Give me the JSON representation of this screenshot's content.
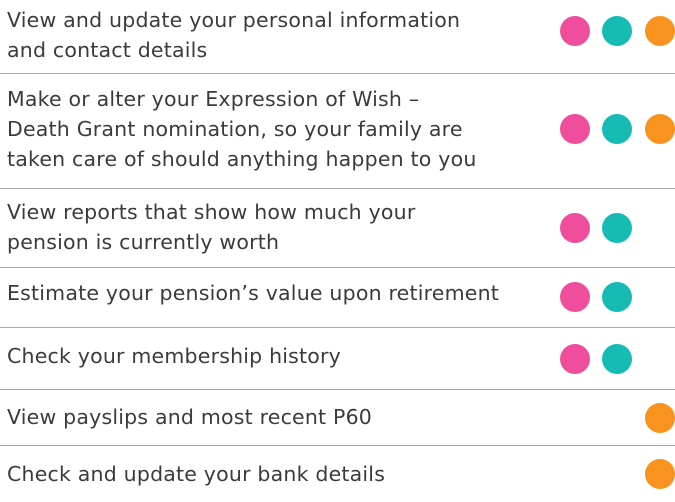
{
  "colors": {
    "pink": "#ee4e9c",
    "teal": "#16bcb3",
    "orange": "#f7931e",
    "divider": "#a9a9a9",
    "text": "#3b3b3b"
  },
  "features": [
    {
      "text": "View and update your personal information\nand contact details",
      "indicators": [
        "pink",
        "teal",
        "orange"
      ]
    },
    {
      "text": "Make or alter your Expression of Wish –\nDeath Grant nomination, so your family are\ntaken care of should anything happen to you",
      "indicators": [
        "pink",
        "teal",
        "orange"
      ]
    },
    {
      "text": "View reports that show how much your\npension is currently worth",
      "indicators": [
        "pink",
        "teal"
      ]
    },
    {
      "text": "Estimate your pension’s value upon retirement",
      "indicators": [
        "pink",
        "teal"
      ]
    },
    {
      "text": "Check your membership history",
      "indicators": [
        "pink",
        "teal"
      ]
    },
    {
      "text": "View payslips and most recent P60",
      "indicators": [
        "orange"
      ]
    },
    {
      "text": "Check and update your bank details",
      "indicators": [
        "orange"
      ]
    }
  ]
}
